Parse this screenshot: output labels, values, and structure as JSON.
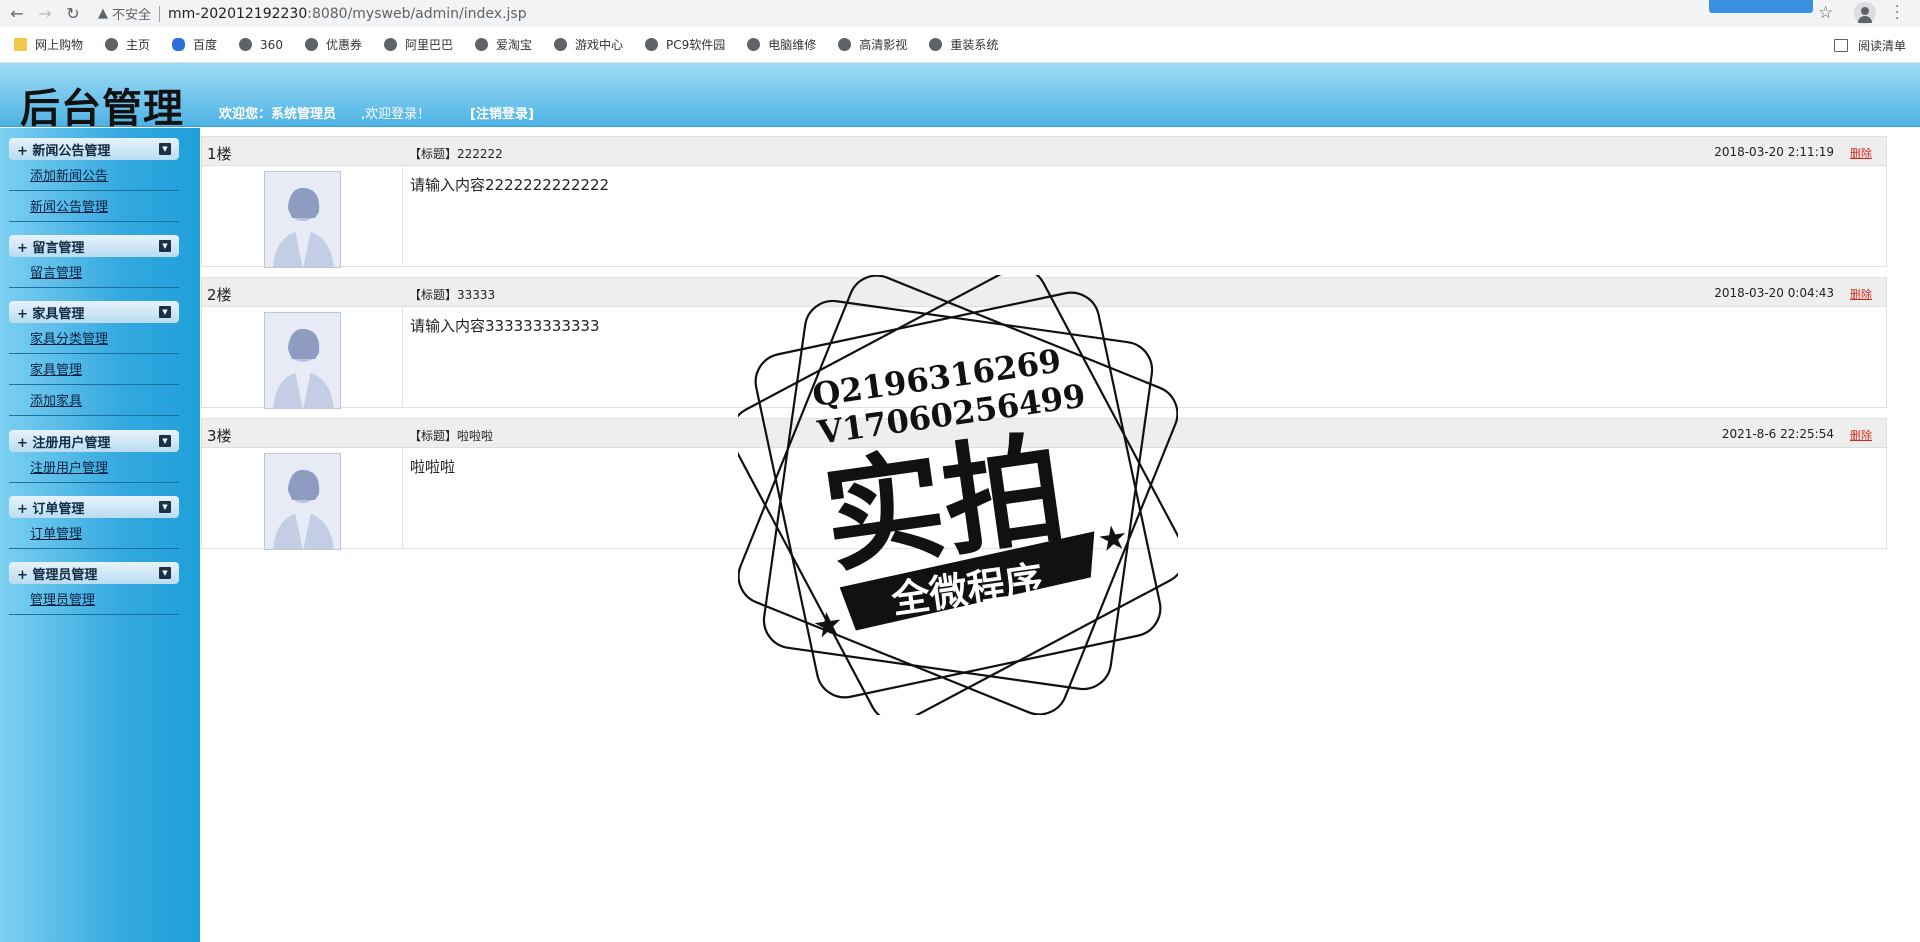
{
  "browser": {
    "insecure_label": "不安全",
    "url_host": "mm-202012192230",
    "url_path": ":8080/mysweb/admin/index.jsp",
    "bookmarks": [
      "网上购物",
      "主页",
      "百度",
      "360",
      "优惠券",
      "阿里巴巴",
      "爱淘宝",
      "游戏中心",
      "PC9软件园",
      "电脑维修",
      "高清影视",
      "重装系统"
    ],
    "reading_list": "阅读清单"
  },
  "header": {
    "title": "后台管理",
    "welcome_prefix": "欢迎您：系统管理员",
    "welcome_suffix": ",欢迎登录！",
    "logout": "[注销登录]"
  },
  "sidebar": {
    "groups": [
      {
        "title": "+ 新闻公告管理",
        "items": [
          "添加新闻公告",
          "新闻公告管理"
        ]
      },
      {
        "title": "+ 留言管理",
        "items": [
          "留言管理"
        ]
      },
      {
        "title": "+ 家具管理",
        "items": [
          "家具分类管理",
          "家具管理",
          "添加家具"
        ]
      },
      {
        "title": "+ 注册用户管理",
        "items": [
          "注册用户管理"
        ]
      },
      {
        "title": "+ 订单管理",
        "items": [
          "订单管理"
        ]
      },
      {
        "title": "+ 管理员管理",
        "items": [
          "管理员管理"
        ]
      }
    ]
  },
  "posts": [
    {
      "floor": "1楼",
      "title": "【标题】222222",
      "date": "2018-03-20 2:11:19",
      "delete": "删除",
      "content": "请输入内容2222222222222"
    },
    {
      "floor": "2楼",
      "title": "【标题】33333",
      "date": "2018-03-20 0:04:43",
      "delete": "删除",
      "content": "请输入内容333333333333"
    },
    {
      "floor": "3楼",
      "title": "【标题】啦啦啦",
      "date": "2021-8-6 22:25:54",
      "delete": "删除",
      "content": "啦啦啦"
    }
  ],
  "watermark": {
    "line1": "Q2196316269",
    "line2": "V17060256499",
    "main": "实拍",
    "banner": "全微程序"
  }
}
